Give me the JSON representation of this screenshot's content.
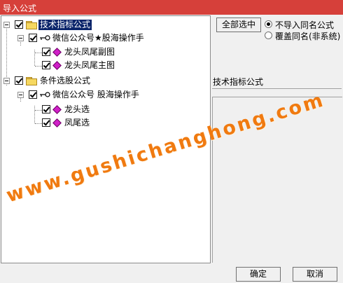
{
  "window": {
    "title": "导入公式"
  },
  "tree": {
    "nodes": [
      {
        "label": "技术指标公式",
        "selected": true
      },
      {
        "label": "微信公众号★股海操作手"
      },
      {
        "label": "龙头凤尾副图"
      },
      {
        "label": "龙头凤尾主图"
      },
      {
        "label": "条件选股公式"
      },
      {
        "label": "微信公众号 股海操作手"
      },
      {
        "label": "龙头选"
      },
      {
        "label": "凤尾选"
      }
    ]
  },
  "options": {
    "select_all_label": "全部选中",
    "radio_no_import": "不导入同名公式",
    "radio_overwrite": "覆盖同名(非系统)",
    "selected_radio": "radio_no_import"
  },
  "detail": {
    "category_label": "技术指标公式"
  },
  "footer": {
    "ok_label": "确定",
    "cancel_label": "取消"
  },
  "watermark": {
    "text": "www.gushichanghong.com"
  },
  "colors": {
    "titlebar": "#d6403a",
    "selection": "#0a246a",
    "watermark": "#f07a10",
    "diamond": "#d020c8"
  }
}
